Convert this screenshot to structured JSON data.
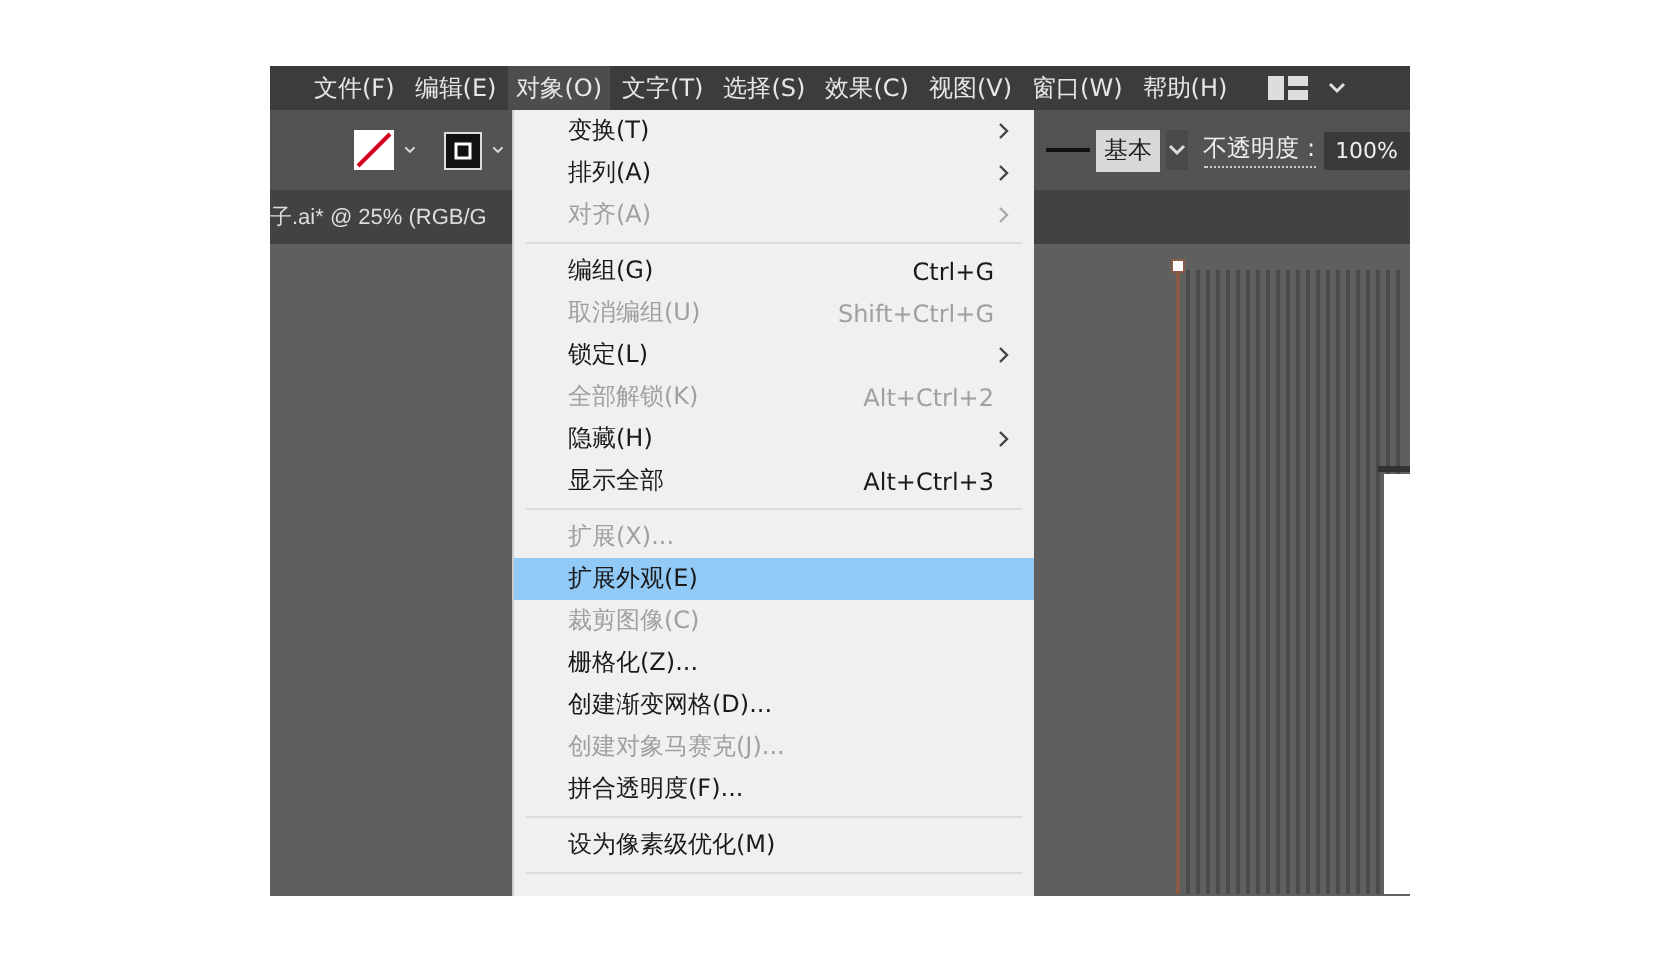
{
  "menu_bar": {
    "items": [
      {
        "label": "文件(F)",
        "selected": false
      },
      {
        "label": "编辑(E)",
        "selected": false
      },
      {
        "label": "对象(O)",
        "selected": true
      },
      {
        "label": "文字(T)",
        "selected": false
      },
      {
        "label": "选择(S)",
        "selected": false
      },
      {
        "label": "效果(C)",
        "selected": false
      },
      {
        "label": "视图(V)",
        "selected": false
      },
      {
        "label": "窗口(W)",
        "selected": false
      },
      {
        "label": "帮助(H)",
        "selected": false
      }
    ]
  },
  "toolbar": {
    "stroke_style": "基本",
    "opacity_label": "不透明度 :",
    "opacity_value": "100%"
  },
  "document_tab": {
    "title": "子.ai* @ 25% (RGB/G"
  },
  "dropdown": {
    "sections": [
      [
        {
          "label": "变换(T)",
          "submenu": true,
          "disabled": false,
          "selected": false
        },
        {
          "label": "排列(A)",
          "submenu": true,
          "disabled": false,
          "selected": false
        },
        {
          "label": "对齐(A)",
          "submenu": true,
          "disabled": true,
          "selected": false
        }
      ],
      [
        {
          "label": "编组(G)",
          "shortcut": "Ctrl+G",
          "submenu": false,
          "disabled": false,
          "selected": false
        },
        {
          "label": "取消编组(U)",
          "shortcut": "Shift+Ctrl+G",
          "submenu": false,
          "disabled": true,
          "selected": false
        },
        {
          "label": "锁定(L)",
          "submenu": true,
          "disabled": false,
          "selected": false
        },
        {
          "label": "全部解锁(K)",
          "shortcut": "Alt+Ctrl+2",
          "submenu": false,
          "disabled": true,
          "selected": false
        },
        {
          "label": "隐藏(H)",
          "submenu": true,
          "disabled": false,
          "selected": false
        },
        {
          "label": "显示全部",
          "shortcut": "Alt+Ctrl+3",
          "submenu": false,
          "disabled": false,
          "selected": false
        }
      ],
      [
        {
          "label": "扩展(X)...",
          "submenu": false,
          "disabled": true,
          "selected": false
        },
        {
          "label": "扩展外观(E)",
          "submenu": false,
          "disabled": false,
          "selected": true
        },
        {
          "label": "裁剪图像(C)",
          "submenu": false,
          "disabled": true,
          "selected": false
        },
        {
          "label": "栅格化(Z)...",
          "submenu": false,
          "disabled": false,
          "selected": false
        },
        {
          "label": "创建渐变网格(D)...",
          "submenu": false,
          "disabled": false,
          "selected": false
        },
        {
          "label": "创建对象马赛克(J)...",
          "submenu": false,
          "disabled": true,
          "selected": false
        },
        {
          "label": "拼合透明度(F)...",
          "submenu": false,
          "disabled": false,
          "selected": false
        }
      ],
      [
        {
          "label": "设为像素级优化(M)",
          "submenu": false,
          "disabled": false,
          "selected": false
        }
      ]
    ]
  }
}
